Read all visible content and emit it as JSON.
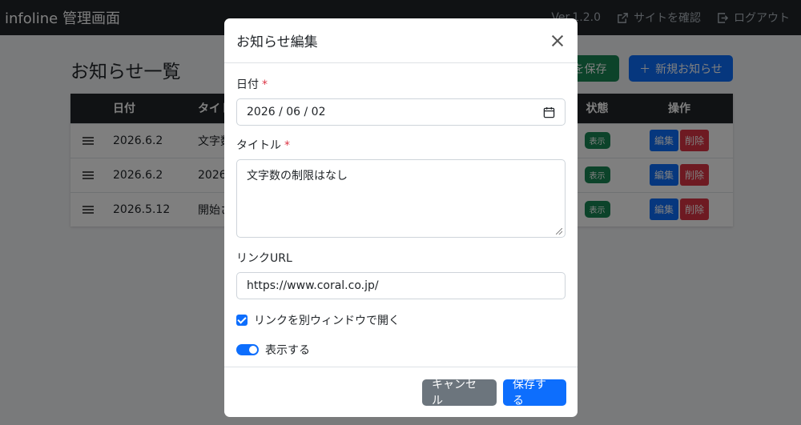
{
  "navbar": {
    "brand": "infoline 管理画面",
    "version": "Ver.1.2.0",
    "site_link": "サイトを確認",
    "logout": "ログアウト"
  },
  "page": {
    "title": "お知らせ一覧",
    "save_order_label": "を保存",
    "new_label": "新規お知らせ",
    "new_icon": "＋"
  },
  "table": {
    "headers": [
      "",
      "日付",
      "タイト",
      "状態",
      "操作"
    ],
    "rows": [
      {
        "date": "2026.6.2",
        "title": "文字数",
        "status": "表示",
        "edit": "編集",
        "delete": "削除"
      },
      {
        "date": "2026.6.2",
        "title": "2026",
        "status": "表示",
        "edit": "編集",
        "delete": "削除"
      },
      {
        "date": "2026.5.12",
        "title": "開始さ",
        "status": "表示",
        "edit": "編集",
        "delete": "削除"
      }
    ]
  },
  "modal": {
    "title": "お知らせ編集",
    "date_label": "日付",
    "required_mark": "*",
    "date_value": "2026 / 06 / 02",
    "title_label": "タイトル",
    "title_value": "文字数の制限はなし",
    "url_label": "リンクURL",
    "url_value": "https://www.coral.co.jp/",
    "new_window_label": "リンクを別ウィンドウで開く",
    "new_window_checked": true,
    "visible_label": "表示する",
    "visible_on": true,
    "cancel_label": "キャンセル",
    "submit_label": "保存する"
  },
  "colors": {
    "primary": "#0d6efd",
    "success": "#198754",
    "danger": "#dc3545",
    "secondary": "#6c757d",
    "dark": "#212529"
  }
}
